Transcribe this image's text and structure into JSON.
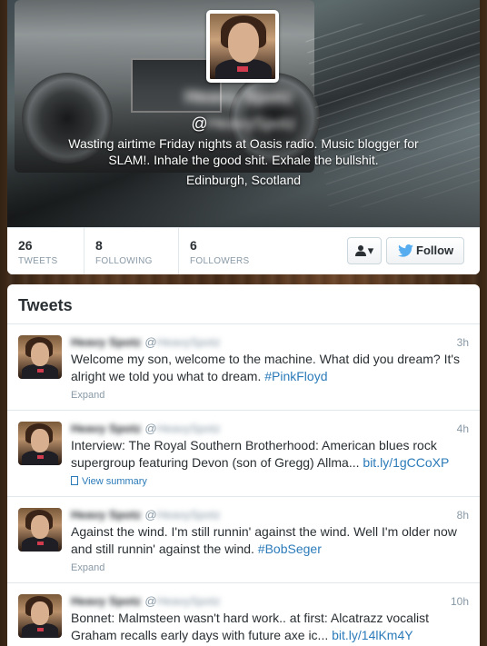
{
  "profile": {
    "display_name": "Heavy Spotz",
    "screen_name_prefix": "@",
    "screen_name_rest": "HeavySpotz",
    "bio": "Wasting airtime Friday nights at Oasis radio. Music blogger for SLAM!. Inhale the good shit. Exhale the bullshit.",
    "location": "Edinburgh, Scotland"
  },
  "stats": [
    {
      "value": "26",
      "label": "TWEETS"
    },
    {
      "value": "8",
      "label": "FOLLOWING"
    },
    {
      "value": "6",
      "label": "FOLLOWERS"
    }
  ],
  "actions": {
    "user_dropdown_glyph": "▾",
    "follow_label": "Follow"
  },
  "tweets_section": {
    "heading": "Tweets",
    "items": [
      {
        "fullname": "Heavy Spotz",
        "handle_prefix": "@",
        "handle_rest": "HeavySpotz",
        "time": "3h",
        "text": "Welcome my son, welcome to the machine. What did you dream? It's alright we told you what to dream. ",
        "link": "#PinkFloyd",
        "action": "Expand"
      },
      {
        "fullname": "Heavy Spotz",
        "handle_prefix": "@",
        "handle_rest": "HeavySpotz",
        "time": "4h",
        "text": "Interview: The Royal Southern Brotherhood: American blues rock supergroup featuring Devon (son of Gregg) Allma... ",
        "link": "bit.ly/1gCCoXP",
        "action": "View summary"
      },
      {
        "fullname": "Heavy Spotz",
        "handle_prefix": "@",
        "handle_rest": "HeavySpotz",
        "time": "8h",
        "text": "Against the wind. I'm still runnin' against the wind. Well I'm older now and still runnin' against the wind. ",
        "link": "#BobSeger",
        "action": "Expand"
      },
      {
        "fullname": "Heavy Spotz",
        "handle_prefix": "@",
        "handle_rest": "HeavySpotz",
        "time": "10h",
        "text": "Bonnet: Malmsteen wasn't hard work.. at first: Alcatrazz vocalist Graham recalls early days with future axe ic... ",
        "link": "bit.ly/14lKm4Y",
        "action": ""
      }
    ]
  },
  "colors": {
    "link": "#2b7bb9",
    "muted": "#8899a6",
    "twitter_blue": "#55acee"
  }
}
